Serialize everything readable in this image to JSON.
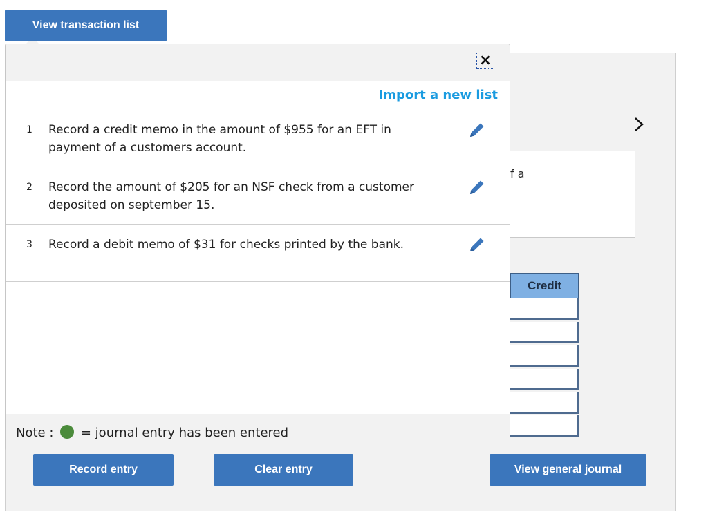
{
  "top_button": {
    "label": "View transaction list"
  },
  "popup": {
    "close_glyph": "×",
    "import_link": "Import a new list",
    "transactions": [
      {
        "num": "1",
        "text": "Record a credit memo in the amount of $955 for an EFT in payment of a customers account.",
        "icon": "pencil-icon"
      },
      {
        "num": "2",
        "text": "Record the amount of $205 for an NSF check from a customer deposited on september 15.",
        "icon": "pencil-icon"
      },
      {
        "num": "3",
        "text": "Record a debit memo of $31 for checks printed by the bank.",
        "icon": "pencil-icon"
      }
    ],
    "note": {
      "prefix": "Note :",
      "suffix": "= journal entry has been entered",
      "dot_color": "#4b8b3b"
    }
  },
  "background": {
    "chevron": "›",
    "partial_text": "f a",
    "credit_header": "Credit"
  },
  "actions": {
    "record_entry": "Record entry",
    "clear_entry": "Clear entry",
    "view_general_journal": "View general journal"
  },
  "colors": {
    "button": "#3b76bc",
    "link": "#1a9be0",
    "credit_header": "#7fb0e3"
  }
}
